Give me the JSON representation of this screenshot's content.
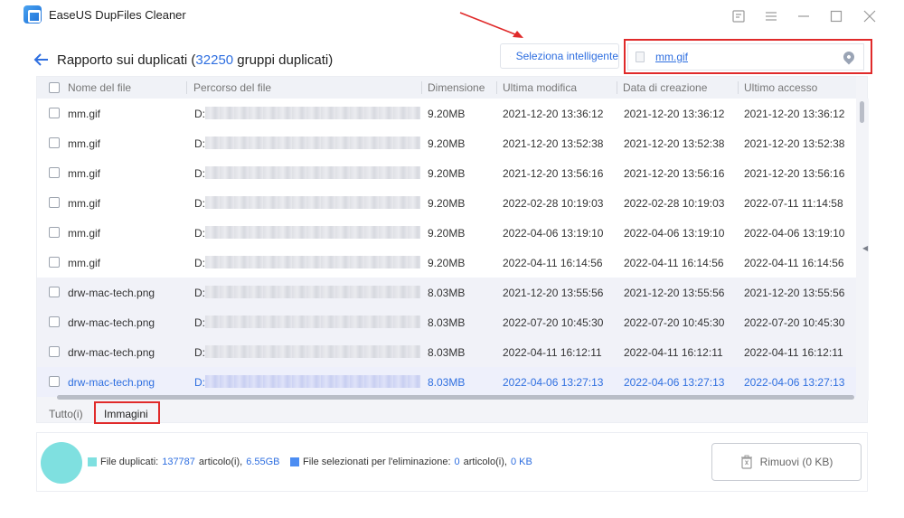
{
  "app": {
    "title": "EaseUS DupFiles Cleaner"
  },
  "window_controls": [
    "feedback-icon",
    "menu-icon",
    "minimize-icon",
    "maximize-icon",
    "close-icon"
  ],
  "header": {
    "title_prefix": "Rapporto sui duplicati (",
    "group_count": "32250",
    "title_suffix": " gruppi duplicati)",
    "smart_select_label": "Seleziona intelligente",
    "search_value": "mm.gif"
  },
  "table": {
    "columns": [
      "Nome del file",
      "Percorso del file",
      "Dimensione",
      "Ultima modifica",
      "Data di creazione",
      "Ultimo accesso"
    ],
    "rows": [
      {
        "name": "mm.gif",
        "path": "D:",
        "size": "9.20MB",
        "modified": "2021-12-20 13:36:12",
        "created": "2021-12-20 13:36:12",
        "accessed": "2021-12-20 13:36:12"
      },
      {
        "name": "mm.gif",
        "path": "D:",
        "size": "9.20MB",
        "modified": "2021-12-20 13:52:38",
        "created": "2021-12-20 13:52:38",
        "accessed": "2021-12-20 13:52:38"
      },
      {
        "name": "mm.gif",
        "path": "D:",
        "size": "9.20MB",
        "modified": "2021-12-20 13:56:16",
        "created": "2021-12-20 13:56:16",
        "accessed": "2021-12-20 13:56:16"
      },
      {
        "name": "mm.gif",
        "path": "D:",
        "size": "9.20MB",
        "modified": "2022-02-28 10:19:03",
        "created": "2022-02-28 10:19:03",
        "accessed": "2022-07-11 11:14:58"
      },
      {
        "name": "mm.gif",
        "path": "D:",
        "size": "9.20MB",
        "modified": "2022-04-06 13:19:10",
        "created": "2022-04-06 13:19:10",
        "accessed": "2022-04-06 13:19:10"
      },
      {
        "name": "mm.gif",
        "path": "D:",
        "size": "9.20MB",
        "modified": "2022-04-11 16:14:56",
        "created": "2022-04-11 16:14:56",
        "accessed": "2022-04-11 16:14:56"
      },
      {
        "name": "drw-mac-tech.png",
        "path": "D:",
        "size": "8.03MB",
        "modified": "2021-12-20 13:55:56",
        "created": "2021-12-20 13:55:56",
        "accessed": "2021-12-20 13:55:56"
      },
      {
        "name": "drw-mac-tech.png",
        "path": "D:",
        "size": "8.03MB",
        "modified": "2022-07-20 10:45:30",
        "created": "2022-07-20 10:45:30",
        "accessed": "2022-07-20 10:45:30"
      },
      {
        "name": "drw-mac-tech.png",
        "path": "D:",
        "size": "8.03MB",
        "modified": "2022-04-11 16:12:11",
        "created": "2022-04-11 16:12:11",
        "accessed": "2022-04-11 16:12:11"
      },
      {
        "name": "drw-mac-tech.png",
        "path": "D:",
        "size": "8.03MB",
        "modified": "2022-04-06 13:27:13",
        "created": "2022-04-06 13:27:13",
        "accessed": "2022-04-06 13:27:13"
      }
    ]
  },
  "tabs": [
    "Tutto(i)",
    "Immagini"
  ],
  "footer": {
    "dup_label": "File duplicati: ",
    "dup_count": "137787",
    "dup_mid": " articolo(i), ",
    "dup_size": "6.55GB",
    "sel_label": "File selezionati per l'eliminazione: ",
    "sel_count": "0",
    "sel_mid": " articolo(i), ",
    "sel_size": "0 KB",
    "remove_label": "Rimuovi (0 KB)"
  },
  "colors": {
    "accent": "#2f6fe0",
    "highlight": "#e02a2a",
    "dup_swatch": "#7fe0e0",
    "sel_swatch": "#4c8df2"
  }
}
